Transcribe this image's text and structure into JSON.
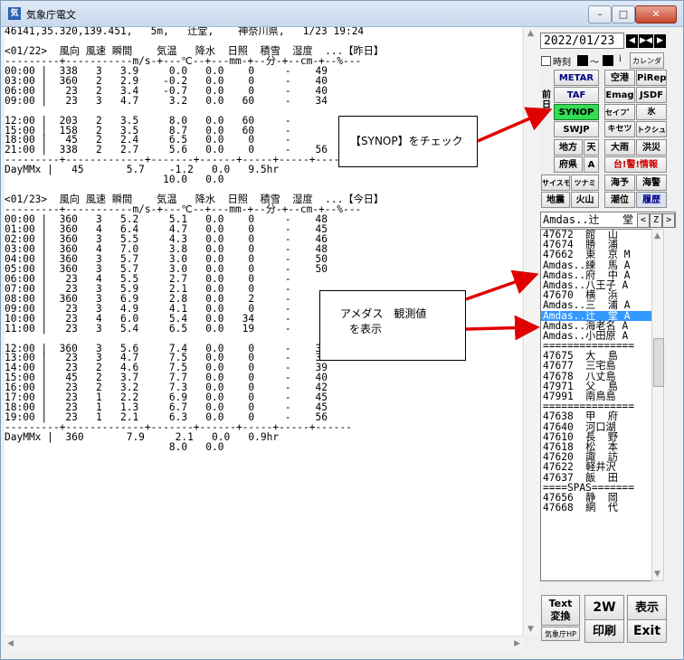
{
  "window": {
    "title": "気象庁電文",
    "min": "–",
    "max": "□",
    "close": "✕"
  },
  "report_lines": [
    "46141,35.320,139.451,   5m,   辻堂,    神奈川県,   1/23 19:24",
    "",
    "<01/22>  風向 風速 瞬間    気温   降水  日照  積雪  湿度  ...【昨日】",
    "---------+-----------m/s-+---℃--+---mm-+--分-+--cm-+--%---",
    "00:00 |  338   3   3.9     0.0   0.0    0     -    49",
    "03:00 |  360   2   2.9    -0.2   0.0    0     -    40",
    "06:00 |   23   2   3.4    -0.7   0.0    0     -    40",
    "09:00 |   23   3   4.7     3.2   0.0   60     -    34",
    "",
    "12:00 |  203   2   3.5     8.0   0.0   60     -",
    "15:00 |  158   2   3.5     8.7   0.0   60     -",
    "18:00 |   45   2   2.4     6.5   0.0    0     -",
    "21:00 |  338   2   2.7     5.6   0.0    0     -    56",
    "---------+-------------+-------+------+-----+-----+------",
    "DayMMx |   45       5.7    -1.2   0.0   9.5hr",
    "                          10.0   0.0",
    "",
    "<01/23>  風向 風速 瞬間    気温   降水  日照  積雪  湿度  ...【今日】",
    "---------+-----------m/s-+---℃--+---mm-+--分-+--cm-+--%---",
    "00:00 |  360   3   5.2     5.1   0.0    0     -    48",
    "01:00 |  360   4   6.4     4.7   0.0    0     -    45",
    "02:00 |  360   3   5.5     4.3   0.0    0     -    46",
    "03:00 |  360   4   7.0     3.8   0.0    0     -    48",
    "04:00 |  360   3   5.7     3.0   0.0    0     -    50",
    "05:00 |  360   3   5.7     3.0   0.0    0     -    50",
    "06:00 |   23   4   5.5     2.7   0.0    0     -",
    "07:00 |   23   3   5.9     2.1   0.0    0     -",
    "08:00 |  360   3   6.9     2.8   0.0    2     -",
    "09:00 |   23   3   4.9     4.1   0.0    0     -",
    "10:00 |   23   4   6.0     5.4   0.0   34     -",
    "11:00 |   23   3   5.4     6.5   0.0   19     -",
    "",
    "12:00 |  360   3   5.6     7.4   0.0    0     -    38",
    "13:00 |   23   3   4.7     7.5   0.0    0     -    37",
    "14:00 |   23   2   4.6     7.5   0.0    0     -    39",
    "15:00 |   45   2   3.7     7.7   0.0    0     -    40",
    "16:00 |   23   2   3.2     7.3   0.0    0     -    42",
    "17:00 |   23   1   2.2     6.9   0.0    0     -    45",
    "18:00 |   23   1   1.3     6.7   0.0    0     -    45",
    "19:00 |   23   1   2.1     6.3   0.0    0     -    56",
    "---------+-------------+-------+------+-----+-----+------",
    "DayMMx |  360       7.9     2.1   0.0   0.9hr",
    "                           8.0   0.0"
  ],
  "panel": {
    "date": "2022/01/23",
    "prev": "◀",
    "mid": "▶◀",
    "next": "▶",
    "time_label": "時刻",
    "tilde": "〜",
    "info": "i",
    "calendar": "カレンダ",
    "prev_day_label": "前日",
    "buttons": {
      "metar": "METAR",
      "airport": "空港",
      "pirep": "PiRep",
      "taf": "TAF",
      "emag": "Emag",
      "jsdf": "JSDF",
      "synop": "SYNOP",
      "safety": "セイフ゜ウ",
      "ice": "氷",
      "swjp": "SWJP",
      "kisetsu": "キセツ",
      "tokushu": "トクシュ",
      "chiho": "地方",
      "ten": "天",
      "ooame": "大雨",
      "kouzui": "洪災",
      "fuken": "府県",
      "a": "A",
      "taifu": "台!警!情報",
      "saizumo": "サイスモ",
      "tsunami": "ツナミ",
      "kaiyo": "海予",
      "kaikei": "海警",
      "jishin": "地震",
      "kazan": "火山",
      "choui": "潮位",
      "rireki": "履歴"
    },
    "list_header": "Amdas..辻",
    "list_header_tail": "堂",
    "list_lt": "<",
    "list_z": "Z",
    "list_gt": ">",
    "stations": [
      "47672  館  山",
      "47674  勝  浦",
      "47662  東  京 M",
      "Amdas..練  馬 A",
      "Amdas..府  中 A",
      "Amdas..八王子 A",
      "47670  横  浜",
      "Amdas..三  浦 A",
      "Amdas..辻  堂 A",
      "Amdas..海老名 A",
      "Amdas..小田原 A",
      "===============",
      "47675  大  島",
      "47677  三宅島",
      "47678  八丈島",
      "47971  父  島",
      "47991  南鳥島",
      "===============",
      "47638  甲  府",
      "47640  河口湖",
      "47610  長  野",
      "47618  松  本",
      "47620  諏  訪",
      "47622  軽井沢",
      "47637  飯  田",
      "====SPAS=======",
      "47656  静  岡",
      "47668  網  代"
    ],
    "selected_index": 8,
    "bottom": {
      "text_top": "Text",
      "text_bottom": "変換",
      "jma_hp": "気象庁HP",
      "two_w": "2W",
      "display": "表示",
      "print": "印刷",
      "exit": "Exit"
    }
  },
  "annotations": {
    "synop_note": "【SYNOP】をチェック",
    "amedas_note_1": "アメダス　観測値",
    "amedas_note_2": "を表示"
  },
  "colors": {
    "arrow": "#e00000",
    "synop_green": "#33dd55",
    "selection": "#3399ff"
  }
}
